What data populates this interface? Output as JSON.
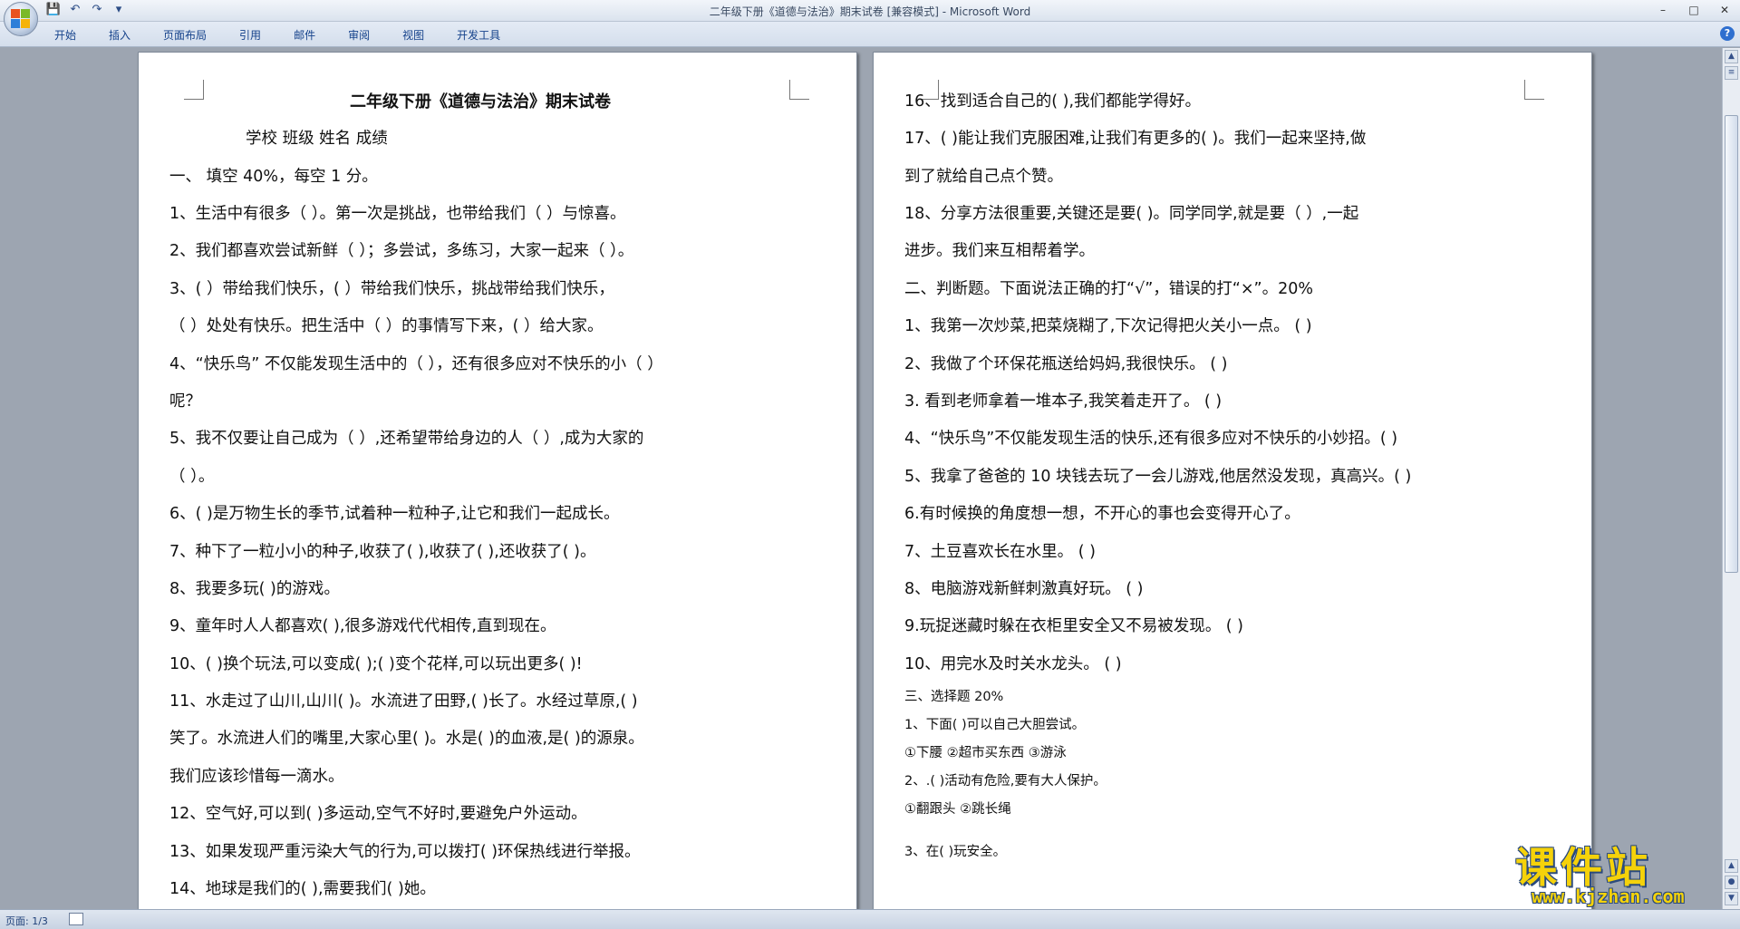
{
  "window": {
    "title": "二年级下册《道德与法治》期末试卷 [兼容模式] - Microsoft Word",
    "controls": [
      "–",
      "□",
      "✕"
    ]
  },
  "ribbon": {
    "tabs": [
      "开始",
      "插入",
      "页面布局",
      "引用",
      "邮件",
      "审阅",
      "视图",
      "开发工具"
    ],
    "help": "?"
  },
  "quick_access": {
    "save": "💾",
    "undo": "↶",
    "redo": "↷",
    "more": "▾"
  },
  "status": {
    "page": "页面: 1/3"
  },
  "watermark": {
    "text": "课件站",
    "url": "www.kjzhan.com"
  },
  "left_page": [
    "二年级下册《道德与法治》期末试卷",
    "学校                    班级                    姓名               成绩",
    "一、   填空 40%，每空 1 分。",
    "1、生活中有很多（       ）。第一次是挑战，也带给我们（       ）与惊喜。",
    "2、我们都喜欢尝试新鲜（      ）；多尝试，多练习，大家一起来（       ）。",
    "3、(          ）带给我们快乐，(         ）带给我们快乐，挑战带给我们快乐，",
    "（       ）处处有快乐。把生活中（        ）的事情写下来，(        ）给大家。",
    "4、“快乐鸟” 不仅能发现生活中的（  ），还有很多应对不快乐的小（    ）",
    "呢？",
    "5、我不仅要让自己成为（     ）,还希望带给身边的人（       ）,成为大家的",
    "（    ）。",
    "6、(          )是万物生长的季节,试着种一粒种子,让它和我们一起成长。",
    "7、种下了一粒小小的种子,收获了(      ),收获了(       ),还收获了(      )。",
    "8、我要多玩(          )的游戏。",
    "9、童年时人人都喜欢(        ),很多游戏代代相传,直到现在。",
    "10、(     )换个玩法,可以变成(     );(     )变个花样,可以玩出更多(       )!",
    "11、水走过了山川,山川(  )。水流进了田野,(    )长了。水经过草原,(    )",
    "笑了。水流进人们的嘴里,大家心里(  )。水是(   )的血液,是(     )的源泉。",
    "我们应该珍惜每一滴水。",
    "12、空气好,可以到(   )多运动,空气不好时,要避免户外运动。",
    "13、如果发现严重污染大气的行为,可以拨打(     )环保热线进行举报。",
    "14、地球是我们的(     ),需要我们(     )她。"
  ],
  "right_page": [
    "16、找到适合自己的(       ),我们都能学得好。",
    "17、(      )能让我们克服困难,让我们有更多的(      )。我们一起来坚持,做",
    "到了就给自己点个赞。",
    "18、分享方法很重要,关键还是要(        )。同学同学,就是要（        ）,一起",
    "进步。我们来互相帮着学。",
    "二、判断题。下面说法正确的打“√”，错误的打“×”。20%",
    "1、我第一次炒菜,把菜烧糊了,下次记得把火关小一点。            (      )",
    "2、我做了个环保花瓶送给妈妈,我很快乐。                                   (       )",
    "3. 看到老师拿着一堆本子,我笑着走开了。                                     (       )",
    "4、“快乐鸟”不仅能发现生活的快乐,还有很多应对不快乐的小妙招。(     )",
    "5、我拿了爸爸的 10 块钱去玩了一会儿游戏,他居然没发现，真高兴。(     )",
    "6.有时候换的角度想一想，不开心的事也会变得开心了。",
    "7、土豆喜欢长在水里。                                                                     (   )",
    "8、电脑游戏新鲜刺激真好玩。                                                          (      )",
    "9.玩捉迷藏时躲在衣柜里安全又不易被发现。                                    (      )",
    "10、用完水及时关水龙头。                                                               (      )",
    "三、选择题 20%",
    "1、下面(       )可以自己大胆尝试。",
    "①下腰                      ②超市买东西                      ③游泳",
    "2、.(        )活动有危险,要有大人保护。",
    "①翻跟头                                  ②跳长绳",
    "3、在(          )玩安全。"
  ]
}
